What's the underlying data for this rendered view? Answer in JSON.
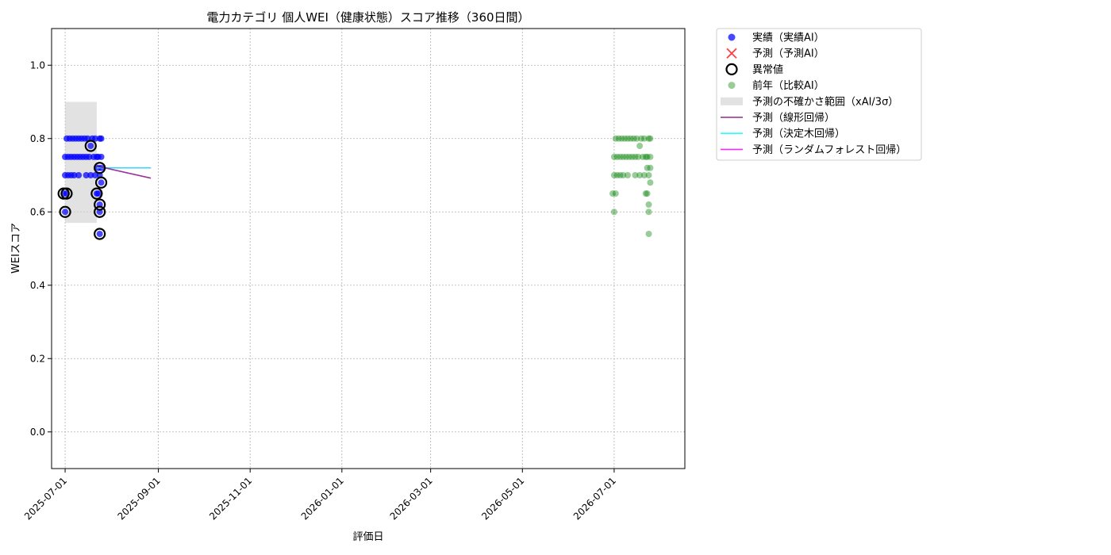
{
  "chart_data": {
    "type": "scatter",
    "title": "電力カテゴリ 個人WEI（健康状態）スコア推移（360日間）",
    "xlabel": "評価日",
    "ylabel": "WEIスコア",
    "xlim": [
      "2025-06-22",
      "2026-08-17"
    ],
    "ylim": [
      -0.1,
      1.1
    ],
    "x_ticks": [
      "2025-07-01",
      "2025-09-01",
      "2025-11-01",
      "2026-01-01",
      "2026-03-01",
      "2026-05-01",
      "2026-07-01"
    ],
    "y_ticks": [
      0.0,
      0.2,
      0.4,
      0.6,
      0.8,
      1.0
    ],
    "grid": true,
    "legend_position": "outside-top-right",
    "legend": [
      {
        "label": "実績（実績AI）",
        "kind": "dot",
        "color": "#0000ff"
      },
      {
        "label": "予測（予測AI）",
        "kind": "cross",
        "color": "#ff0000"
      },
      {
        "label": "異常値",
        "kind": "ring",
        "color": "#000000"
      },
      {
        "label": "前年（比較AI）",
        "kind": "dot",
        "color": "#008000"
      },
      {
        "label": "予測の不確かさ範囲（xAI/3σ）",
        "kind": "band",
        "color": "#d3d3d3"
      },
      {
        "label": "予測（線形回帰）",
        "kind": "line",
        "color": "#800080"
      },
      {
        "label": "予測（決定木回帰）",
        "kind": "line",
        "color": "#00ffff"
      },
      {
        "label": "予測（ランダムフォレスト回帰）",
        "kind": "line",
        "color": "#ff00ff"
      }
    ],
    "series": [
      {
        "name": "実績（実績AI）",
        "color": "#0000ff",
        "points": [
          [
            "2025-06-30",
            0.65
          ],
          [
            "2025-07-01",
            0.6
          ],
          [
            "2025-07-01",
            0.7
          ],
          [
            "2025-07-01",
            0.75
          ],
          [
            "2025-07-02",
            0.8
          ],
          [
            "2025-07-02",
            0.65
          ],
          [
            "2025-07-03",
            0.7
          ],
          [
            "2025-07-03",
            0.75
          ],
          [
            "2025-07-04",
            0.8
          ],
          [
            "2025-07-05",
            0.7
          ],
          [
            "2025-07-05",
            0.75
          ],
          [
            "2025-07-06",
            0.8
          ],
          [
            "2025-07-07",
            0.75
          ],
          [
            "2025-07-07",
            0.7
          ],
          [
            "2025-07-08",
            0.8
          ],
          [
            "2025-07-09",
            0.75
          ],
          [
            "2025-07-10",
            0.7
          ],
          [
            "2025-07-10",
            0.8
          ],
          [
            "2025-07-11",
            0.75
          ],
          [
            "2025-07-12",
            0.8
          ],
          [
            "2025-07-13",
            0.75
          ],
          [
            "2025-07-14",
            0.8
          ],
          [
            "2025-07-15",
            0.75
          ],
          [
            "2025-07-15",
            0.7
          ],
          [
            "2025-07-16",
            0.8
          ],
          [
            "2025-07-17",
            0.75
          ],
          [
            "2025-07-18",
            0.78
          ],
          [
            "2025-07-18",
            0.7
          ],
          [
            "2025-07-19",
            0.8
          ],
          [
            "2025-07-20",
            0.75
          ],
          [
            "2025-07-21",
            0.7
          ],
          [
            "2025-07-21",
            0.8
          ],
          [
            "2025-07-22",
            0.65
          ],
          [
            "2025-07-22",
            0.75
          ],
          [
            "2025-07-23",
            0.72
          ],
          [
            "2025-07-23",
            0.65
          ],
          [
            "2025-07-24",
            0.6
          ],
          [
            "2025-07-24",
            0.7
          ],
          [
            "2025-07-24",
            0.54
          ],
          [
            "2025-07-24",
            0.62
          ],
          [
            "2025-07-25",
            0.68
          ],
          [
            "2025-07-25",
            0.75
          ],
          [
            "2025-07-25",
            0.72
          ],
          [
            "2025-07-25",
            0.8
          ],
          [
            "2025-07-24",
            0.8
          ],
          [
            "2025-07-23",
            0.75
          ]
        ]
      },
      {
        "name": "異常値",
        "color": "#000000",
        "points": [
          [
            "2025-06-30",
            0.65
          ],
          [
            "2025-07-01",
            0.6
          ],
          [
            "2025-07-02",
            0.65
          ],
          [
            "2025-07-18",
            0.78
          ],
          [
            "2025-07-22",
            0.65
          ],
          [
            "2025-07-24",
            0.72
          ],
          [
            "2025-07-24",
            0.6
          ],
          [
            "2025-07-24",
            0.54
          ],
          [
            "2025-07-24",
            0.62
          ],
          [
            "2025-07-25",
            0.68
          ]
        ]
      },
      {
        "name": "前年（比較AI）",
        "color": "#008000",
        "points": [
          [
            "2026-06-30",
            0.65
          ],
          [
            "2026-07-01",
            0.6
          ],
          [
            "2026-07-01",
            0.7
          ],
          [
            "2026-07-01",
            0.75
          ],
          [
            "2026-07-02",
            0.8
          ],
          [
            "2026-07-02",
            0.65
          ],
          [
            "2026-07-03",
            0.7
          ],
          [
            "2026-07-03",
            0.75
          ],
          [
            "2026-07-04",
            0.8
          ],
          [
            "2026-07-05",
            0.7
          ],
          [
            "2026-07-05",
            0.75
          ],
          [
            "2026-07-06",
            0.8
          ],
          [
            "2026-07-07",
            0.75
          ],
          [
            "2026-07-07",
            0.7
          ],
          [
            "2026-07-08",
            0.8
          ],
          [
            "2026-07-09",
            0.75
          ],
          [
            "2026-07-10",
            0.7
          ],
          [
            "2026-07-10",
            0.8
          ],
          [
            "2026-07-11",
            0.75
          ],
          [
            "2026-07-12",
            0.8
          ],
          [
            "2026-07-13",
            0.75
          ],
          [
            "2026-07-14",
            0.8
          ],
          [
            "2026-07-15",
            0.75
          ],
          [
            "2026-07-15",
            0.7
          ],
          [
            "2026-07-16",
            0.8
          ],
          [
            "2026-07-17",
            0.75
          ],
          [
            "2026-07-18",
            0.78
          ],
          [
            "2026-07-18",
            0.7
          ],
          [
            "2026-07-19",
            0.8
          ],
          [
            "2026-07-20",
            0.75
          ],
          [
            "2026-07-21",
            0.7
          ],
          [
            "2026-07-21",
            0.8
          ],
          [
            "2026-07-22",
            0.65
          ],
          [
            "2026-07-22",
            0.75
          ],
          [
            "2026-07-23",
            0.72
          ],
          [
            "2026-07-23",
            0.65
          ],
          [
            "2026-07-24",
            0.6
          ],
          [
            "2026-07-24",
            0.7
          ],
          [
            "2026-07-24",
            0.54
          ],
          [
            "2026-07-24",
            0.62
          ],
          [
            "2026-07-25",
            0.68
          ],
          [
            "2026-07-25",
            0.75
          ],
          [
            "2026-07-25",
            0.72
          ],
          [
            "2026-07-25",
            0.8
          ],
          [
            "2026-07-24",
            0.8
          ],
          [
            "2026-07-23",
            0.75
          ]
        ]
      }
    ],
    "uncertainty_band": {
      "x_range": [
        "2025-07-01",
        "2025-07-22"
      ],
      "y_range": [
        0.57,
        0.9
      ],
      "color": "#d3d3d3"
    },
    "lines": [
      {
        "name": "予測（ランダムフォレスト回帰）",
        "color": "#ff00ff",
        "points": [
          [
            "2025-07-22",
            0.72
          ],
          [
            "2025-08-27",
            0.72
          ]
        ]
      },
      {
        "name": "予測（決定木回帰）",
        "color": "#00ffff",
        "points": [
          [
            "2025-07-22",
            0.72
          ],
          [
            "2025-08-27",
            0.72
          ]
        ]
      },
      {
        "name": "予測（線形回帰）",
        "color": "#800080",
        "points": [
          [
            "2025-07-22",
            0.725
          ],
          [
            "2025-08-27",
            0.692
          ]
        ]
      }
    ]
  }
}
